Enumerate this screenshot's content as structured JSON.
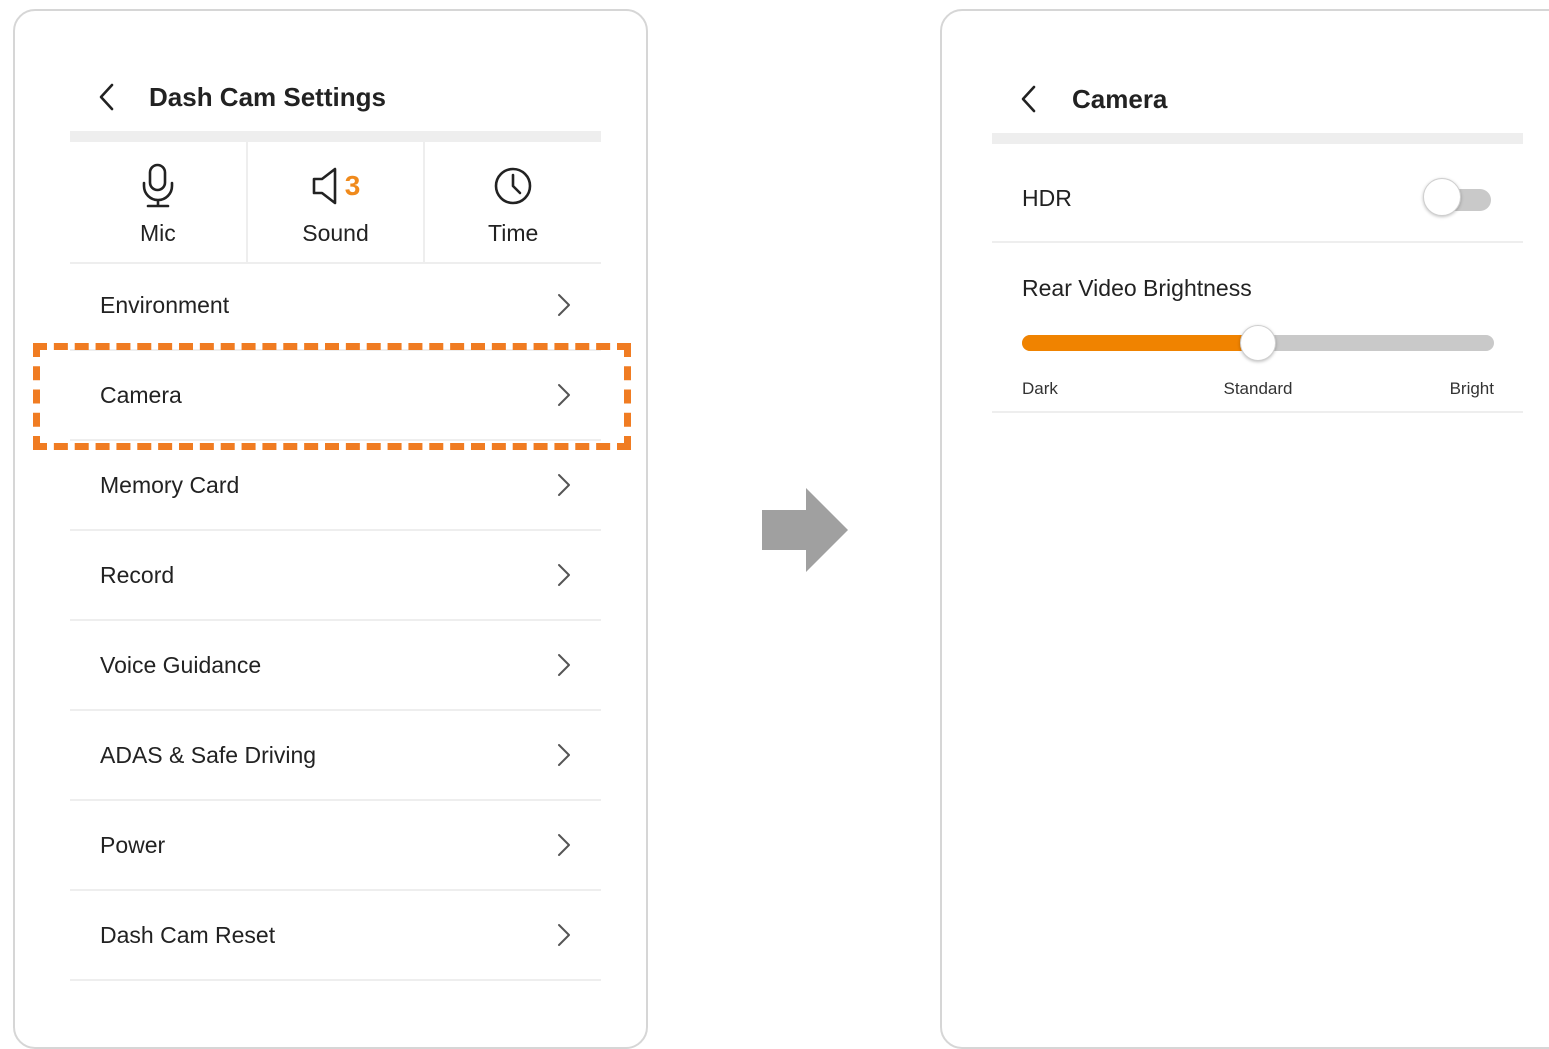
{
  "left_screen": {
    "title": "Dash Cam Settings",
    "quick_settings": [
      {
        "label": "Mic",
        "icon": "microphone-icon"
      },
      {
        "label": "Sound",
        "icon": "speaker-icon",
        "value": "3"
      },
      {
        "label": "Time",
        "icon": "clock-icon"
      }
    ],
    "menu_items": [
      {
        "label": "Environment"
      },
      {
        "label": "Camera",
        "highlighted": true
      },
      {
        "label": "Memory Card"
      },
      {
        "label": "Record"
      },
      {
        "label": "Voice Guidance"
      },
      {
        "label": "ADAS & Safe Driving"
      },
      {
        "label": "Power"
      },
      {
        "label": "Dash Cam Reset"
      }
    ]
  },
  "right_screen": {
    "title": "Camera",
    "hdr": {
      "label": "HDR",
      "enabled": false
    },
    "brightness": {
      "label": "Rear Video Brightness",
      "value_fraction": 0.5,
      "scale_labels": [
        "Dark",
        "Standard",
        "Bright"
      ]
    }
  },
  "colors": {
    "accent": "#f08300",
    "highlight": "#f07c22",
    "divider": "#eeeeee",
    "arrow": "#a0a0a0"
  }
}
